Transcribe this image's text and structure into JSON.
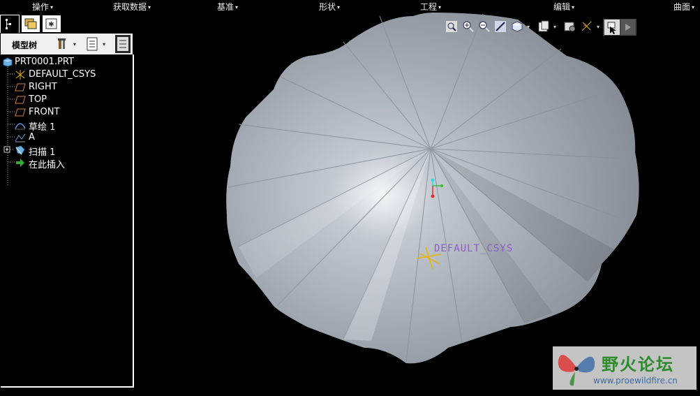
{
  "menu": {
    "items": [
      "操作",
      "获取数据",
      "基准",
      "形状",
      "工程",
      "编辑",
      "曲面"
    ]
  },
  "model_tree": {
    "title": "模型树",
    "items": [
      {
        "label": "PRT0001.PRT",
        "icon": "part-icon"
      },
      {
        "label": "DEFAULT_CSYS",
        "icon": "csys-icon"
      },
      {
        "label": "RIGHT",
        "icon": "datum-plane-icon"
      },
      {
        "label": "TOP",
        "icon": "datum-plane-icon"
      },
      {
        "label": "FRONT",
        "icon": "datum-plane-icon"
      },
      {
        "label": "草绘 1",
        "icon": "sketch-icon"
      },
      {
        "label": "A",
        "icon": "axis-icon"
      },
      {
        "label": "扫描 1",
        "icon": "sweep-icon"
      },
      {
        "label": "在此插入",
        "icon": "insert-arrow-icon"
      }
    ]
  },
  "viewport": {
    "csys_label": "DEFAULT_CSYS"
  },
  "watermark": {
    "title": "野火论坛",
    "url": "www.proewildfire.cn"
  },
  "colors": {
    "background": "#000000",
    "surface": "#a9afb8",
    "csys_label": "#8a5cc8",
    "csys_mark": "#e6b400",
    "watermark_green": "#2d8a2d"
  }
}
